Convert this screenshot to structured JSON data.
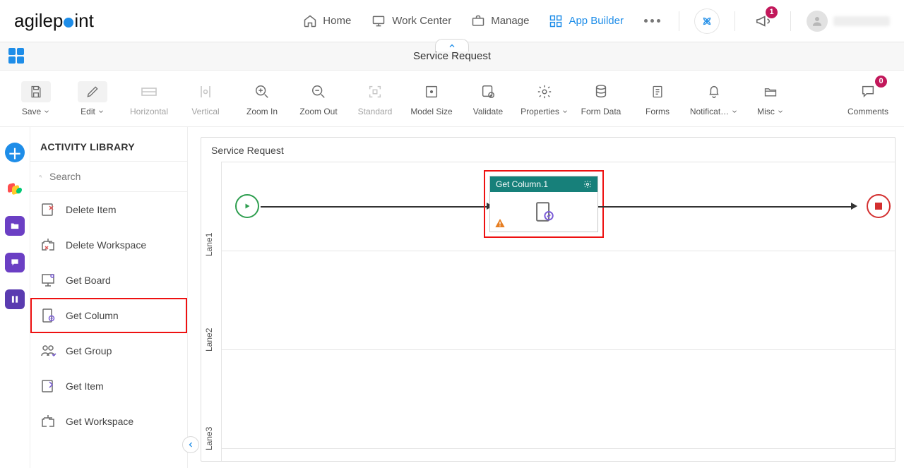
{
  "brand": "agilepoint",
  "nav": {
    "home": "Home",
    "workcenter": "Work Center",
    "manage": "Manage",
    "appbuilder": "App Builder"
  },
  "notifications_badge": "1",
  "comments_badge": "0",
  "page_title": "Service Request",
  "toolbar": {
    "save": "Save",
    "edit": "Edit",
    "horizontal": "Horizontal",
    "vertical": "Vertical",
    "zoomin": "Zoom In",
    "zoomout": "Zoom Out",
    "standard": "Standard",
    "modelsize": "Model Size",
    "validate": "Validate",
    "properties": "Properties",
    "formdata": "Form Data",
    "forms": "Forms",
    "notifications": "Notificat…",
    "misc": "Misc",
    "comments": "Comments"
  },
  "sidebar": {
    "title": "ACTIVITY LIBRARY",
    "search_placeholder": "Search",
    "items": [
      {
        "label": "Delete Item"
      },
      {
        "label": "Delete Workspace"
      },
      {
        "label": "Get Board"
      },
      {
        "label": "Get Column"
      },
      {
        "label": "Get Group"
      },
      {
        "label": "Get Item"
      },
      {
        "label": "Get Workspace"
      }
    ],
    "highlight_index": 3
  },
  "canvas": {
    "title": "Service Request",
    "lanes": [
      "Lane1",
      "Lane2",
      "Lane3"
    ],
    "activity": {
      "title": "Get Column.1"
    }
  }
}
